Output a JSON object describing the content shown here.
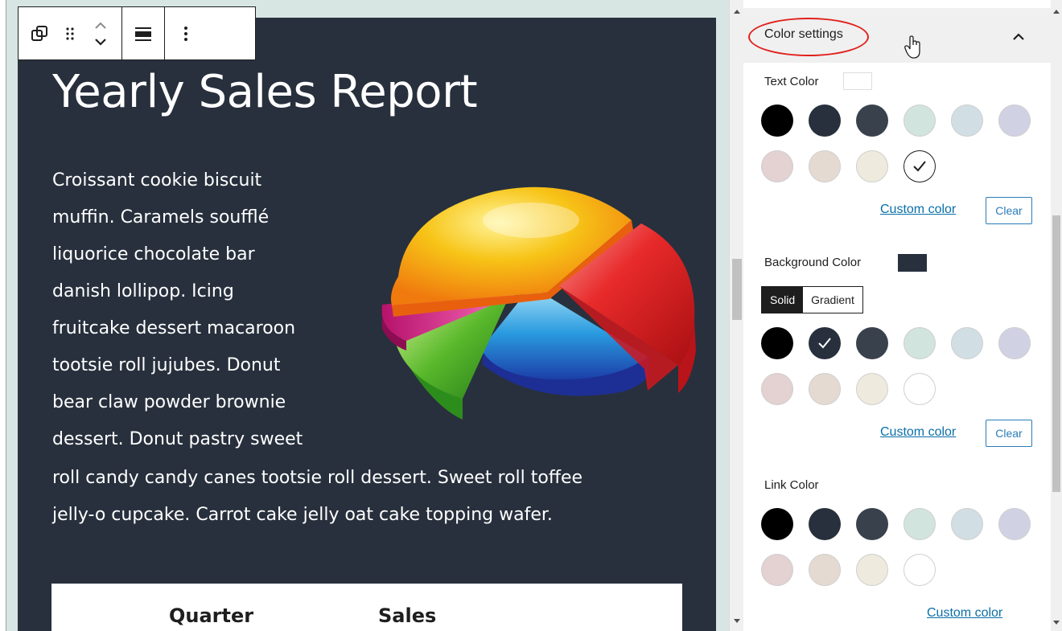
{
  "editor": {
    "title": "Yearly Sales Report",
    "paragraph_lines": [
      "Croissant cookie biscuit",
      "muffin. Caramels soufflé",
      "liquorice chocolate bar",
      "danish lollipop. Icing",
      "fruitcake dessert macaroon",
      "tootsie roll jujubes. Donut",
      "bear claw powder brownie",
      "dessert. Donut pastry sweet",
      "roll candy candy canes tootsie roll dessert. Sweet roll toffee",
      "jelly-o cupcake. Carrot cake jelly oat cake topping wafer."
    ],
    "block_background": "#28303d",
    "table_headers": [
      "Quarter",
      "Sales"
    ]
  },
  "toolbar": {
    "icons": [
      "transform-block-icon",
      "drag-handle-icon",
      "move-up-down-icon",
      "align-icon",
      "more-options-icon"
    ]
  },
  "sidebar": {
    "panel_title": "Color settings",
    "text_color": {
      "label": "Text Color",
      "current": "#ffffff",
      "selected_index": 9,
      "custom_link": "Custom color",
      "clear": "Clear"
    },
    "background_color": {
      "label": "Background Color",
      "current": "#28303d",
      "tabs": [
        "Solid",
        "Gradient"
      ],
      "active_tab": "Solid",
      "selected_index": 1,
      "custom_link": "Custom color",
      "clear": "Clear"
    },
    "link_color": {
      "label": "Link Color",
      "custom_link": "Custom color"
    },
    "palette": [
      "#000000",
      "#28303d",
      "#39414d",
      "#d1e4dd",
      "#d1dfe4",
      "#d1d1e4",
      "#e4d1d1",
      "#e4dad1",
      "#eeeadd",
      "#ffffff"
    ]
  }
}
